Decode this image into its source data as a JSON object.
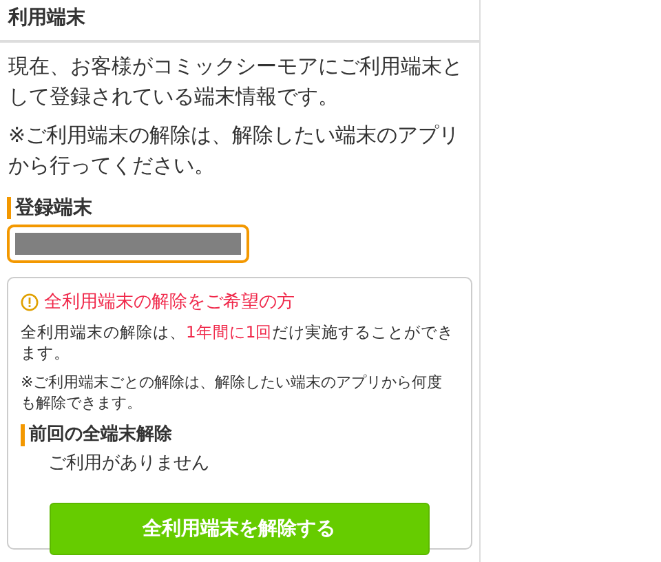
{
  "header": {
    "title": "利用端末"
  },
  "intro": [
    "現在、お客様がコミックシーモアにご利用端末として登録されている端末情報です。",
    "※ご利用端末の解除は、解除したい端末のアプリから行ってください。"
  ],
  "registered": {
    "heading": "登録端末"
  },
  "reset_card": {
    "title": "全利用端末の解除をご希望の方",
    "notice": [
      {
        "text": "全利用端末の解除は、",
        "highlight": false
      },
      {
        "text": "1年間に1回",
        "highlight": true
      },
      {
        "text": "だけ実施することができます。",
        "highlight": false
      }
    ],
    "note": "※ご利用端末ごとの解除は、解除したい端末のアプリから何度も解除できます。",
    "last_heading": "前回の全端末解除",
    "last_value": "ご利用がありません",
    "button": "全利用端末を解除する"
  }
}
